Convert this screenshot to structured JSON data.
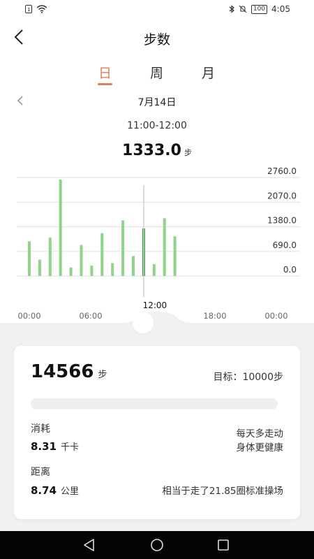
{
  "statusbar": {
    "time": "4:05",
    "battery": "100"
  },
  "header": {
    "title": "步数"
  },
  "tabs": [
    {
      "label": "日",
      "active": true
    },
    {
      "label": "周"
    },
    {
      "label": "月"
    }
  ],
  "date": "7月14日",
  "time_range": "11:00-12:00",
  "selected_steps": {
    "value": "1333.0",
    "unit": "步"
  },
  "chart_data": {
    "type": "bar",
    "y_ticks": [
      "2760.0",
      "2070.0",
      "1380.0",
      "690.0",
      "0.0"
    ],
    "ylim": [
      0,
      2760
    ],
    "x_ticks": [
      "00:00",
      "06:00",
      "12:00",
      "18:00",
      "00:00"
    ],
    "selected_label": "12:00",
    "selected_index": 11,
    "values": [
      970,
      460,
      1080,
      2700,
      240,
      870,
      290,
      1200,
      360,
      1560,
      560,
      1333,
      330,
      1620,
      1110
    ],
    "colors": {
      "bar": "#8fd38c",
      "selected": "#3f9b4a",
      "grid": "#e2e2e2"
    }
  },
  "summary": {
    "total_steps": "14566",
    "steps_unit": "步",
    "goal": "目标：10000步",
    "consumption_label": "消耗",
    "consumption_value": "8.31",
    "consumption_unit": "千卡",
    "note_line1": "每天多走动",
    "note_line2": "身体更健康",
    "distance_label": "距离",
    "distance_value": "8.74",
    "distance_unit": "公里",
    "distance_note": "相当于走了21.85圈标准操场"
  },
  "icons": {
    "back": "back-arrow-icon",
    "prev": "chevron-left-icon"
  }
}
